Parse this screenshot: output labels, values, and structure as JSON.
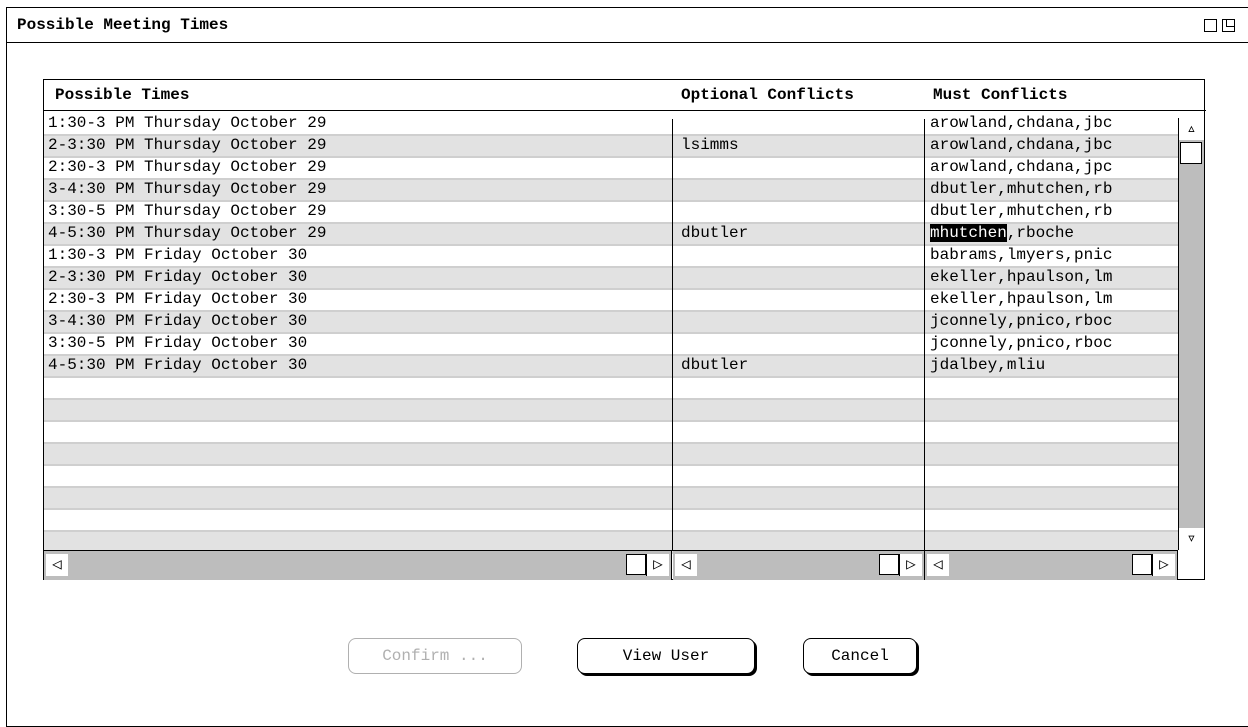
{
  "window": {
    "title": "Possible Meeting Times"
  },
  "table": {
    "headers": {
      "possible_times": "Possible Times",
      "optional_conflicts": "Optional Conflicts",
      "must_conflicts": "Must Conflicts"
    },
    "rows": [
      {
        "time": "1:30-3 PM Thursday October 29",
        "optional": "",
        "must": "arowland,chdana,jbc"
      },
      {
        "time": "2-3:30 PM Thursday October 29",
        "optional": "lsimms",
        "must": "arowland,chdana,jbc"
      },
      {
        "time": "2:30-3 PM Thursday October 29",
        "optional": "",
        "must": "arowland,chdana,jpc"
      },
      {
        "time": "3-4:30 PM Thursday October 29",
        "optional": "",
        "must": "dbutler,mhutchen,rb"
      },
      {
        "time": "3:30-5 PM Thursday October 29",
        "optional": "",
        "must": "dbutler,mhutchen,rb"
      },
      {
        "time": "4-5:30 PM Thursday October 29",
        "optional": "dbutler",
        "must_highlight": "mhutchen",
        "must_rest": ",rboche"
      },
      {
        "time": "1:30-3 PM Friday October 30",
        "optional": "",
        "must": "babrams,lmyers,pnic"
      },
      {
        "time": "2-3:30 PM Friday October 30",
        "optional": "",
        "must": "ekeller,hpaulson,lm"
      },
      {
        "time": "2:30-3 PM Friday October 30",
        "optional": "",
        "must": "ekeller,hpaulson,lm"
      },
      {
        "time": "3-4:30 PM Friday October 30",
        "optional": "",
        "must": "jconnely,pnico,rboc"
      },
      {
        "time": "3:30-5 PM Friday October 30",
        "optional": "",
        "must": "jconnely,pnico,rboc"
      },
      {
        "time": "4-5:30 PM Friday October 30",
        "optional": "dbutler",
        "must": "jdalbey,mliu"
      }
    ],
    "selected_row": "4-5:30 PM Thursday October 29"
  },
  "buttons": {
    "confirm": "Confirm ...",
    "view_user": "View User",
    "cancel": "Cancel"
  },
  "icons": {
    "scroll_up": "▵",
    "scroll_down": "▿",
    "scroll_left": "◁",
    "scroll_right": "▷"
  }
}
